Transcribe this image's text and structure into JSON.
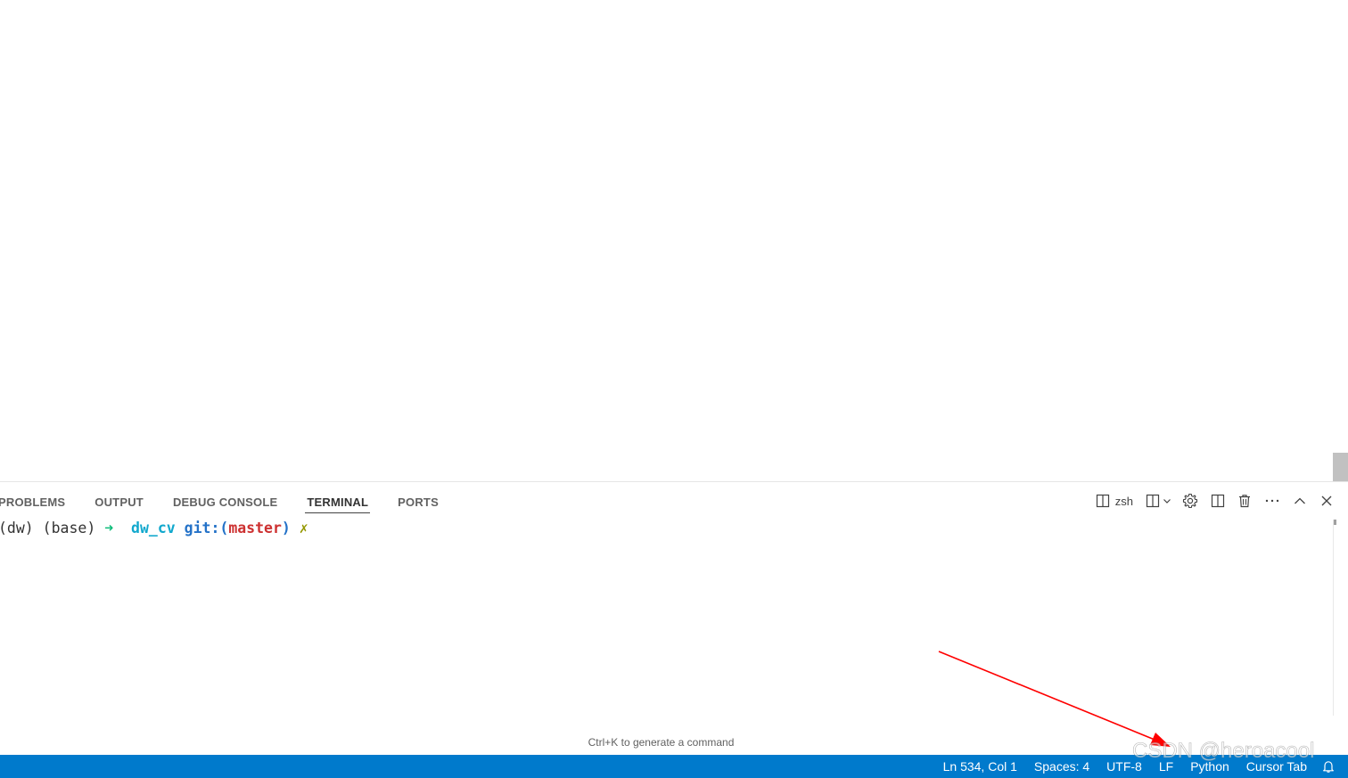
{
  "panel": {
    "tabs": [
      {
        "label": "PROBLEMS",
        "active": false
      },
      {
        "label": "OUTPUT",
        "active": false
      },
      {
        "label": "DEBUG CONSOLE",
        "active": false
      },
      {
        "label": "TERMINAL",
        "active": true
      },
      {
        "label": "PORTS",
        "active": false
      }
    ],
    "terminal_name": "zsh",
    "action_icons": [
      "split-terminal-icon",
      "launch-profile-icon",
      "chevron-down-icon",
      "gear-icon",
      "layout-panel-icon",
      "trash-icon",
      "more-actions-icon",
      "maximize-panel-icon",
      "close-icon"
    ]
  },
  "terminal": {
    "env_prefix": "(dw) (base) ",
    "arrow": "➜",
    "directory": "dw_cv",
    "git_prefix": "git:(",
    "branch": "master",
    "git_suffix": ")",
    "dirty_mark": "✗",
    "hint": "Ctrl+K to generate a command"
  },
  "statusbar": {
    "items": [
      "Ln 534, Col 1",
      "Spaces: 4",
      "UTF-8",
      "LF",
      "Python",
      "Cursor Tab"
    ],
    "bell_icon": "bell-icon",
    "background": "#007acc"
  },
  "annotation": {
    "arrow_color": "#ff0000"
  },
  "watermark": "CSDN @heroacool"
}
